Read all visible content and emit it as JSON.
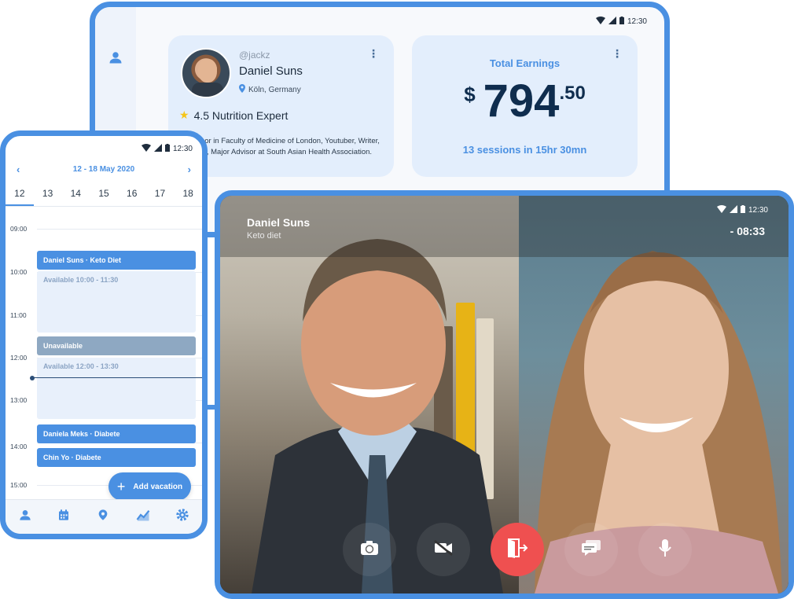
{
  "tablet": {
    "status_time": "12:30",
    "profile": {
      "handle": "@jackz",
      "name": "Daniel Suns",
      "location": "Köln, Germany",
      "rating_text": "4.5 Nutrition Expert",
      "bio": "Professor in Faculty of Medicine of London, Youtuber, Writer, Speaker, Major Advisor at South Asian Health Association."
    },
    "earnings": {
      "title": "Total Earnings",
      "currency": "$",
      "amount": "794",
      "cents": ".50",
      "sessions": "13 sessions in 15hr 30mn"
    }
  },
  "phone": {
    "status_time": "12:30",
    "week_range": "12 - 18 May 2020",
    "days": [
      "12",
      "13",
      "14",
      "15",
      "16",
      "17",
      "18"
    ],
    "hours": [
      "09:00",
      "10:00",
      "11:00",
      "12:00",
      "13:00",
      "14:00",
      "15:00"
    ],
    "events": {
      "keto": "Daniel Suns  · Keto Diet",
      "avail1": "Available 10:00 - 11:30",
      "unavailable": "Unavailable",
      "avail2": "Available 12:00 - 13:30",
      "daniela": "Daniela Meks  · Diabete",
      "chin": "Chin Yo  · Diabete"
    },
    "fab_label": "Add vacation",
    "nav_icons": [
      "user-icon",
      "calendar-icon",
      "map-pin-icon",
      "chart-icon",
      "settings-icon"
    ]
  },
  "call": {
    "caller_name": "Daniel Suns",
    "caller_topic": "Keto diet",
    "status_time": "12:30",
    "timer": "- 08:33",
    "controls": [
      "switch-camera-icon",
      "video-off-icon",
      "end-call-icon",
      "chat-icon",
      "mic-icon"
    ]
  },
  "colors": {
    "accent": "#4a90e2",
    "end_call": "#ef5050",
    "dark_text": "#0f2d4e"
  }
}
